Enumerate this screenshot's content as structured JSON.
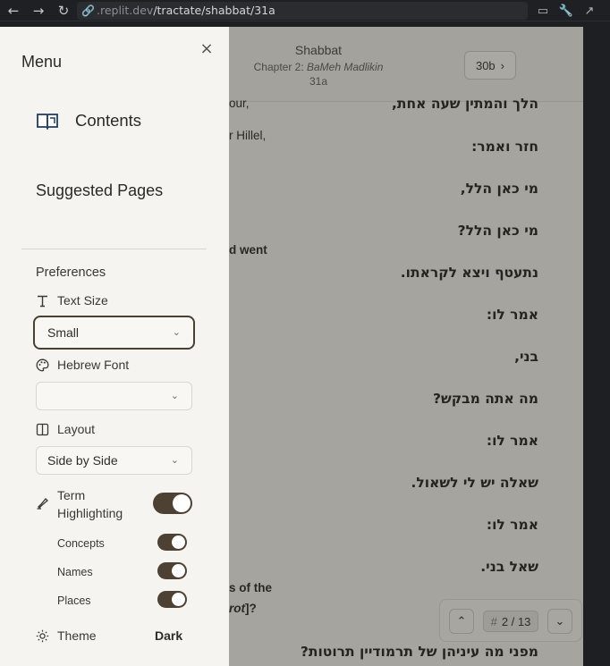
{
  "browser": {
    "url_domain": ".replit.dev",
    "url_path": "/tractate/shabbat/31a",
    "back_icon": "←",
    "forward_icon": "→",
    "reload_icon": "↻"
  },
  "reader": {
    "title": "Shabbat",
    "chapter_prefix": "Chapter 2: ",
    "chapter_name": "BaMeh Madlikin",
    "page": "31a",
    "next_page": "30b",
    "hebrew_lines": [
      "הלך והמתין שעה אחת,",
      "חזר ואמר:",
      "מי כאן הלל,",
      "מי כאן הלל?",
      "נתעטף ויצא לקראתו.",
      "אמר לו:",
      "בני,",
      "מה אתה מבקש?",
      "אמר לו:",
      "שאלה יש לי לשאול.",
      "אמר לו:",
      "שאל בני.",
      "מפני מה עיניהן של תרמודיין תרוטות?"
    ],
    "english_fragments": {
      "l1": "our,",
      "l2": "r Hillel,",
      "l3": "d went",
      "l4": "s of the",
      "l5a": "rot",
      "l5b": "]?"
    },
    "pager": {
      "current": "2 / 13",
      "hash": "#"
    }
  },
  "menu": {
    "title": "Menu",
    "contents_label": "Contents",
    "suggested_label": "Suggested Pages",
    "preferences_label": "Preferences",
    "text_size_label": "Text Size",
    "text_size_value": "Small",
    "hebrew_font_label": "Hebrew Font",
    "hebrew_font_value": "",
    "layout_label": "Layout",
    "layout_value": "Side by Side",
    "term_highlighting_line1": "Term",
    "term_highlighting_line2": "Highlighting",
    "term_highlighting_on": true,
    "concepts_label": "Concepts",
    "names_label": "Names",
    "places_label": "Places",
    "theme_label": "Theme",
    "theme_value": "Dark"
  },
  "colors": {
    "menu_bg": "#f5f4f0",
    "toggle_on": "#4d4133",
    "overlay": "#a5a49f"
  }
}
